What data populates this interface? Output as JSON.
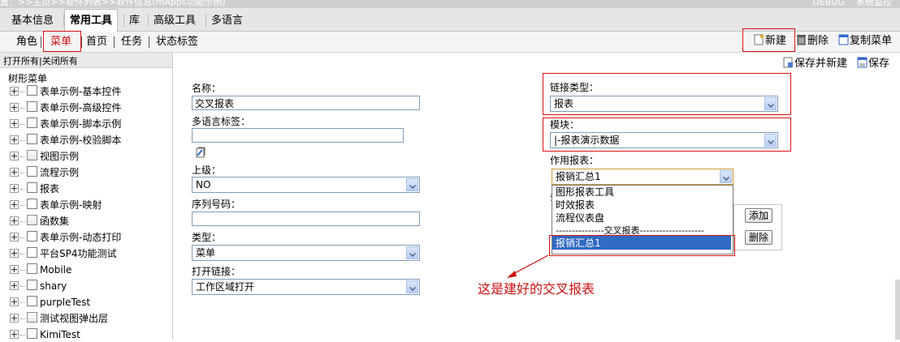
{
  "header": {
    "breadcrumb": "置：>>主页>>软件列表>>软件信息(mApps功能示例)",
    "user": "DEBUG",
    "system_admin": "系统监控"
  },
  "tabs": [
    {
      "label": "基本信息"
    },
    {
      "label": "常用工具",
      "active": true
    },
    {
      "label": "库"
    },
    {
      "label": "高级工具"
    },
    {
      "label": "多语言"
    }
  ],
  "subnav": {
    "items": [
      "角色",
      "菜单",
      "首页",
      "任务",
      "状态标签"
    ],
    "active": "菜单"
  },
  "toolbar": {
    "new_label": "新建",
    "delete_label": "删除",
    "copy_label": "复制菜单",
    "save_new_label": "保存并新建",
    "save_label": "保存"
  },
  "tree": {
    "open_all": "打开所有",
    "close_all": "关闭所有",
    "root": "树形菜单",
    "items": [
      "表单示例-基本控件",
      "表单示例-高级控件",
      "表单示例-脚本示例",
      "表单示例-校验脚本",
      "视图示例",
      "流程示例",
      "报表",
      "表单示例-映射",
      "函数集",
      "表单示例-动态打印",
      "平台SP4功能测试",
      "Mobile",
      "shary",
      "purpleTest",
      "测试视图弹出层",
      "KimiTest"
    ]
  },
  "form": {
    "name_label": "名称：",
    "name_value": "交叉报表",
    "i18n_label": "多语言标签：",
    "i18n_value": "",
    "parent_label": "上级：",
    "parent_value": "NO",
    "order_label": "序列号码：",
    "order_value": "",
    "type_label": "类型：",
    "type_value": "菜单",
    "open_label": "打开链接：",
    "open_value": "工作区域打开",
    "link_type_label": "链接类型：",
    "link_type_value": "报表",
    "module_label": "模块：",
    "module_value": "|-报表演示数据",
    "report_label": "作用报表：",
    "report_value": "报销汇总1",
    "report_options": [
      "图形报表工具",
      "时效报表",
      "流程仪表盘",
      "---------------交叉报表--------------------",
      "报销汇总1"
    ],
    "hidden_label_fragment": "条",
    "add_button": "添加",
    "remove_button": "删除"
  },
  "annotation": {
    "text": "这是建好的交叉报表",
    "color": "#cc1111"
  },
  "colors": {
    "accent_red": "#d11111",
    "select_highlight": "#316ac5"
  }
}
